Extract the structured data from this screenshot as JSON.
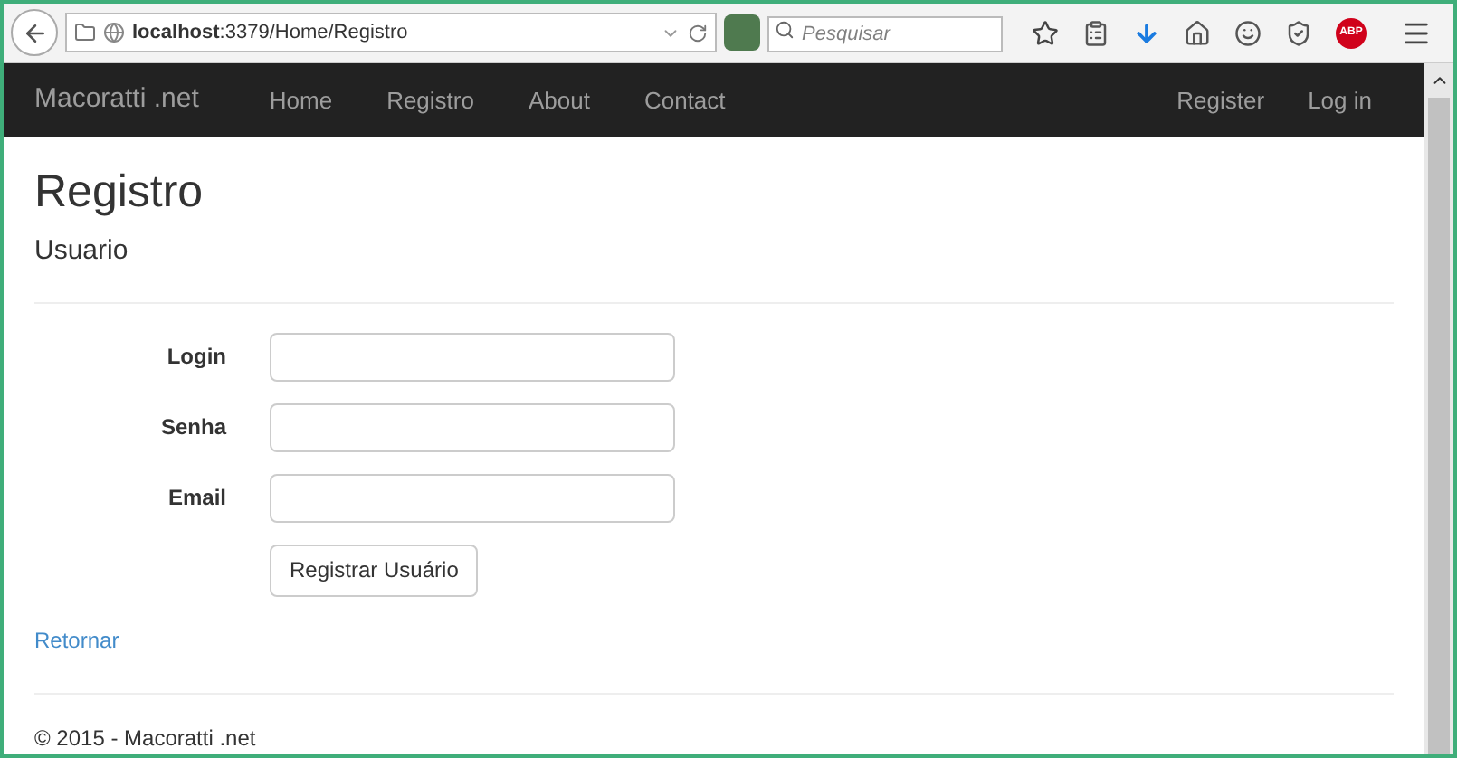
{
  "browser": {
    "address": "**localhost**:3379/Home/Registro",
    "search": {
      "placeholder": "Pesquisar"
    },
    "adblock_badge": "ABP"
  },
  "navbar": {
    "brand": "Macoratti .net",
    "links": [
      "Home",
      "Registro",
      "About",
      "Contact"
    ],
    "right_links": [
      "Register",
      "Log in"
    ]
  },
  "page": {
    "title": "Registro",
    "subtitle": "Usuario",
    "fields": [
      {
        "label": "Login"
      },
      {
        "label": "Senha"
      },
      {
        "label": "Email"
      }
    ],
    "submit": "Registrar Usuário",
    "back_link": "Retornar"
  },
  "footer": "© 2015 - Macoratti .net"
}
